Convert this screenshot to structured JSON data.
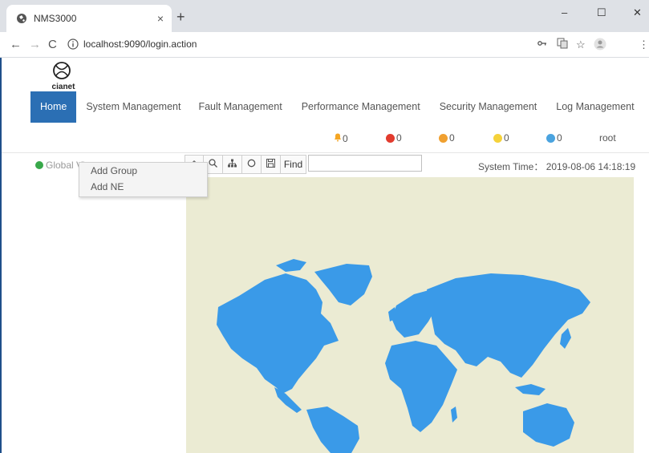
{
  "browser": {
    "tab_title": "NMS3000",
    "tab_close": "×",
    "new_tab": "+",
    "url": "localhost:9090/login.action",
    "window_controls": {
      "minimize": "–",
      "maximize": "☐",
      "close": "✕"
    }
  },
  "app": {
    "logo_text": "cianet",
    "menu": [
      {
        "label": "Home",
        "active": true
      },
      {
        "label": "System Management",
        "active": false
      },
      {
        "label": "Fault Management",
        "active": false
      },
      {
        "label": "Performance Management",
        "active": false
      },
      {
        "label": "Security Management",
        "active": false
      },
      {
        "label": "Log Management",
        "active": false
      }
    ],
    "alarms": [
      {
        "icon": "bell-icon",
        "count": "0",
        "color": "#f5a623"
      },
      {
        "icon": "critical-alarm-icon",
        "count": "0",
        "color": "#e23b2e"
      },
      {
        "icon": "major-alarm-icon",
        "count": "0",
        "color": "#f0a030"
      },
      {
        "icon": "minor-alarm-icon",
        "count": "0",
        "color": "#f5d23a"
      },
      {
        "icon": "warning-alarm-icon",
        "count": "0",
        "color": "#4aa3df"
      }
    ],
    "user": "root",
    "tree_root": "Global View",
    "context_menu": [
      "Add Group",
      "Add NE"
    ],
    "toolbar": {
      "find_label": "Find",
      "search_value": ""
    },
    "system_time_label": "System Time：",
    "system_time": "2019-08-06 14:18:19",
    "colors": {
      "menu_active": "#2b6fb4",
      "map_land": "#3a9ae8",
      "map_background": "#ebebd3"
    }
  }
}
